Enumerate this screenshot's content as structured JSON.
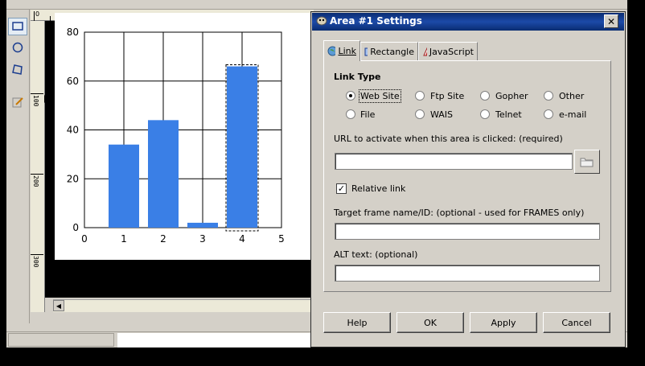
{
  "dialog": {
    "title": "Area #1 Settings",
    "tabs": [
      {
        "label": "Link",
        "hotkey_index": 0,
        "selected": true
      },
      {
        "label": "Rectangle",
        "hotkey_index": 0,
        "selected": false
      },
      {
        "label": "JavaScript",
        "hotkey_index": 0,
        "selected": false
      }
    ],
    "link_type": {
      "heading": "Link Type",
      "options": [
        {
          "label": "Web Site",
          "selected": true
        },
        {
          "label": "Ftp Site",
          "selected": false
        },
        {
          "label": "Gopher",
          "selected": false
        },
        {
          "label": "Other",
          "selected": false
        },
        {
          "label": "File",
          "selected": false
        },
        {
          "label": "WAIS",
          "selected": false
        },
        {
          "label": "Telnet",
          "selected": false
        },
        {
          "label": "e-mail",
          "selected": false
        }
      ]
    },
    "url": {
      "label": "URL to activate when this area is clicked: (required)",
      "value": ""
    },
    "relative_link": {
      "label": "Relative link",
      "checked": true
    },
    "target_frame": {
      "label": "Target frame name/ID: (optional - used for FRAMES only)",
      "value": ""
    },
    "alt_text": {
      "label": "ALT text: (optional)",
      "value": ""
    },
    "buttons": {
      "help": "Help",
      "ok": "OK",
      "apply": "Apply",
      "cancel": "Cancel"
    }
  },
  "editor": {
    "ruler_top": [
      "0"
    ],
    "ruler_left": [
      "100",
      "200",
      "300"
    ]
  },
  "chart_data": {
    "type": "bar",
    "x": [
      1,
      2,
      3,
      4
    ],
    "values": [
      34,
      44,
      2,
      66
    ],
    "xlim": [
      0,
      5
    ],
    "ylim": [
      0,
      80
    ],
    "xticks": [
      "0",
      "1",
      "2",
      "3",
      "4",
      "5"
    ],
    "yticks": [
      "0",
      "20",
      "40",
      "60",
      "80"
    ],
    "grid": true,
    "bar_color": "#3a7fe6",
    "selected_bar_index": 3
  },
  "colors": {
    "titlebar": "#0a2c72",
    "face": "#d4d0c8",
    "bar": "#3a7fe6"
  }
}
